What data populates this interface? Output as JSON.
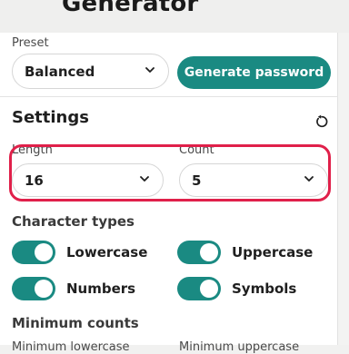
{
  "app": {
    "title": "Generator"
  },
  "preset": {
    "label": "Preset",
    "value": "Balanced"
  },
  "actions": {
    "generate_label": "Generate password"
  },
  "settings": {
    "title": "Settings",
    "length": {
      "label": "Length",
      "value": "16"
    },
    "count": {
      "label": "Count",
      "value": "5"
    }
  },
  "character_types": {
    "title": "Character types",
    "options": [
      {
        "label": "Lowercase",
        "checked": true
      },
      {
        "label": "Uppercase",
        "checked": true
      },
      {
        "label": "Numbers",
        "checked": true
      },
      {
        "label": "Symbols",
        "checked": true
      }
    ]
  },
  "minimum_counts": {
    "title": "Minimum counts",
    "lowercase_label": "Minimum lowercase",
    "uppercase_label": "Minimum uppercase"
  },
  "colors": {
    "accent": "#1a8a82",
    "highlight": "#e0204a"
  },
  "icons": {
    "chevron": "chevron-down-icon",
    "reset": "reset-icon"
  }
}
